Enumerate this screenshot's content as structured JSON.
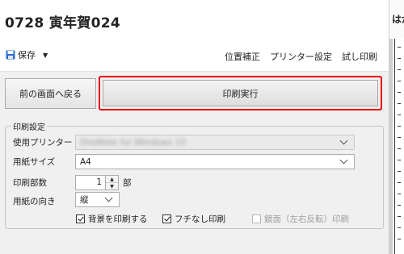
{
  "title": "0728 寅年賀024",
  "toolbar": {
    "save_label": "保存",
    "links": [
      "位置補正",
      "プリンター設定",
      "試し印刷"
    ]
  },
  "buttons": {
    "back": "前の画面へ戻る",
    "execute": "印刷実行"
  },
  "settings": {
    "group_title": "印刷設定",
    "printer": {
      "label": "使用プリンター",
      "value": "OneNote for Windows 10"
    },
    "paper_size": {
      "label": "用紙サイズ",
      "value": "A4"
    },
    "copies": {
      "label": "印刷部数",
      "value": "1",
      "unit": "部"
    },
    "orientation": {
      "label": "用紙の向き",
      "value": "縦"
    },
    "checkboxes": {
      "background": {
        "label": "背景を印刷する",
        "checked": true
      },
      "borderless": {
        "label": "フチなし印刷",
        "checked": true
      },
      "mirror": {
        "label": "鏡面（左右反転）印刷",
        "checked": false,
        "disabled": true
      }
    }
  },
  "side_panel": {
    "heading": "はが"
  },
  "colors": {
    "highlight": "#e60012",
    "save_icon": "#2a6fc9"
  }
}
